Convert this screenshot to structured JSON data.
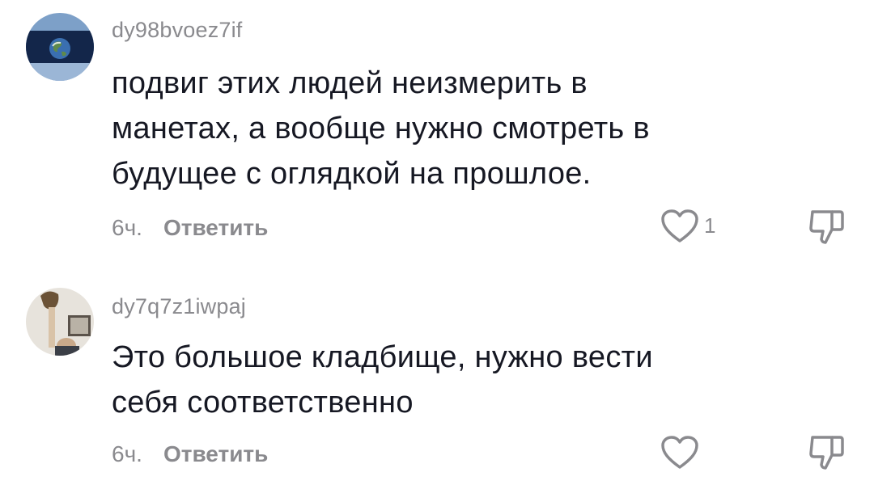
{
  "comments": [
    {
      "username": "dy98bvoez7if",
      "avatar_icon": "earth-flag-avatar",
      "text_lines": [
        "подвиг этих людей неизмерить в",
        "манетах, а вообще нужно смотреть в",
        "будущее с оглядкой на прошлое."
      ],
      "time": "6ч.",
      "reply_label": "Ответить",
      "like_count": "1"
    },
    {
      "username": "dy7q7z1iwpaj",
      "avatar_icon": "person-photo-avatar",
      "text_lines": [
        "Это большое кладбище, нужно вести",
        "себя соответственно"
      ],
      "time": "6ч.",
      "reply_label": "Ответить",
      "like_count": ""
    }
  ],
  "colors": {
    "text": "#161823",
    "secondary": "#8a8a8e",
    "icon_stroke": "#8a8a8e"
  },
  "icons": {
    "like": "heart-outline-icon",
    "dislike": "thumbs-down-outline-icon"
  }
}
